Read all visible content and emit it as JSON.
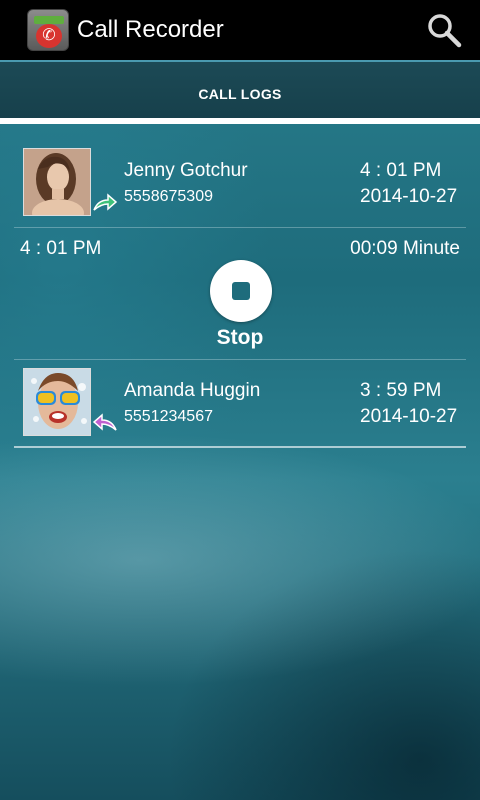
{
  "app": {
    "title": "Call Recorder",
    "icon": "app-recorder-icon",
    "search_icon": "search-icon"
  },
  "tabs": [
    {
      "label": "CALL LOGS",
      "selected": true
    }
  ],
  "player": {
    "time": "4 : 01 PM",
    "duration": "00:09 Minute",
    "stop_label": "Stop",
    "stop_icon": "stop-icon"
  },
  "calls": [
    {
      "name": "Jenny Gotchur",
      "number": "5558675309",
      "time": "4 : 01 PM",
      "date": "2014-10-27",
      "direction": "outgoing",
      "direction_icon": "outgoing-call-arrow-icon",
      "direction_color": "#3ec27a"
    },
    {
      "name": "Amanda Huggin",
      "number": "5551234567",
      "time": "3 : 59 PM",
      "date": "2014-10-27",
      "direction": "incoming",
      "direction_icon": "incoming-call-arrow-icon",
      "direction_color": "#c060d0"
    }
  ],
  "colors": {
    "action_bar": "#000000",
    "tab_strip": "#1c4a56",
    "background": "#1e6c7c",
    "accent": "#ffffff"
  }
}
